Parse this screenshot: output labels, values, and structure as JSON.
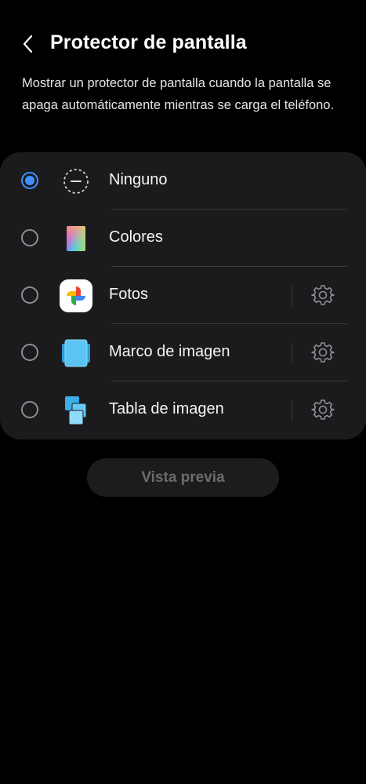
{
  "header": {
    "title": "Protector de pantalla",
    "back_icon": "chevron-left-icon"
  },
  "description": "Mostrar un protector de pantalla cuando la pantalla se apaga automáticamente mientras se carga el teléfono.",
  "options": [
    {
      "label": "Ninguno",
      "icon": "none-dashed-circle-icon",
      "selected": true,
      "has_settings": false
    },
    {
      "label": "Colores",
      "icon": "colors-gradient-icon",
      "selected": false,
      "has_settings": false
    },
    {
      "label": "Fotos",
      "icon": "google-photos-icon",
      "selected": false,
      "has_settings": true
    },
    {
      "label": "Marco de imagen",
      "icon": "picture-frame-icon",
      "selected": false,
      "has_settings": true
    },
    {
      "label": "Tabla de imagen",
      "icon": "picture-table-icon",
      "selected": false,
      "has_settings": true
    }
  ],
  "preview_button": {
    "label": "Vista previa",
    "enabled": false
  },
  "colors": {
    "background": "#000000",
    "card": "#1b1b1d",
    "accent": "#3e91ff",
    "disabled_text": "#6b6b6e"
  }
}
